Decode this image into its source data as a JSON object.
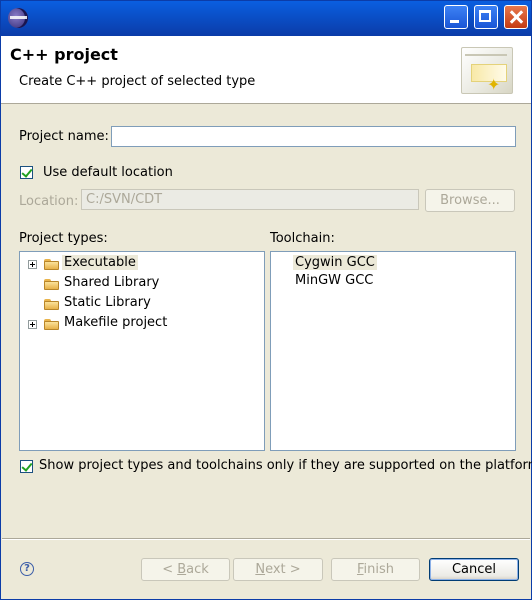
{
  "window": {
    "title": ""
  },
  "header": {
    "title": "C++ project",
    "description": "Create C++ project of selected type"
  },
  "form": {
    "project_name_label": "Project name:",
    "project_name_value": "",
    "use_default_location_label": "Use default location",
    "use_default_location_checked": true,
    "location_label": "Location:",
    "location_value": "C:/SVN/CDT",
    "browse_label": "Browse...",
    "project_types_label": "Project types:",
    "toolchain_label": "Toolchain:",
    "show_supported_label": "Show project types and toolchains only if they are supported on the platform",
    "show_supported_checked": true
  },
  "project_types": [
    {
      "label": "Executable",
      "expandable": true,
      "selected": true
    },
    {
      "label": "Shared Library",
      "expandable": false,
      "selected": false
    },
    {
      "label": "Static Library",
      "expandable": false,
      "selected": false
    },
    {
      "label": "Makefile project",
      "expandable": true,
      "selected": false
    }
  ],
  "toolchains": [
    {
      "label": "Cygwin GCC",
      "selected": true
    },
    {
      "label": "MinGW GCC",
      "selected": false
    }
  ],
  "buttons": {
    "back_prefix": "< ",
    "back_mnemonic": "B",
    "back_rest": "ack",
    "next_mnemonic": "N",
    "next_rest": "ext >",
    "finish_mnemonic": "F",
    "finish_rest": "inish",
    "cancel": "Cancel"
  },
  "help": {
    "glyph": "?"
  },
  "icons": {
    "app": "eclipse-icon",
    "minimize": "minimize-icon",
    "maximize": "maximize-icon",
    "close": "close-icon",
    "folder": "folder-icon",
    "expand": "plus-expander-icon",
    "help": "help-icon",
    "wizard": "new-project-wizard-graphic"
  }
}
